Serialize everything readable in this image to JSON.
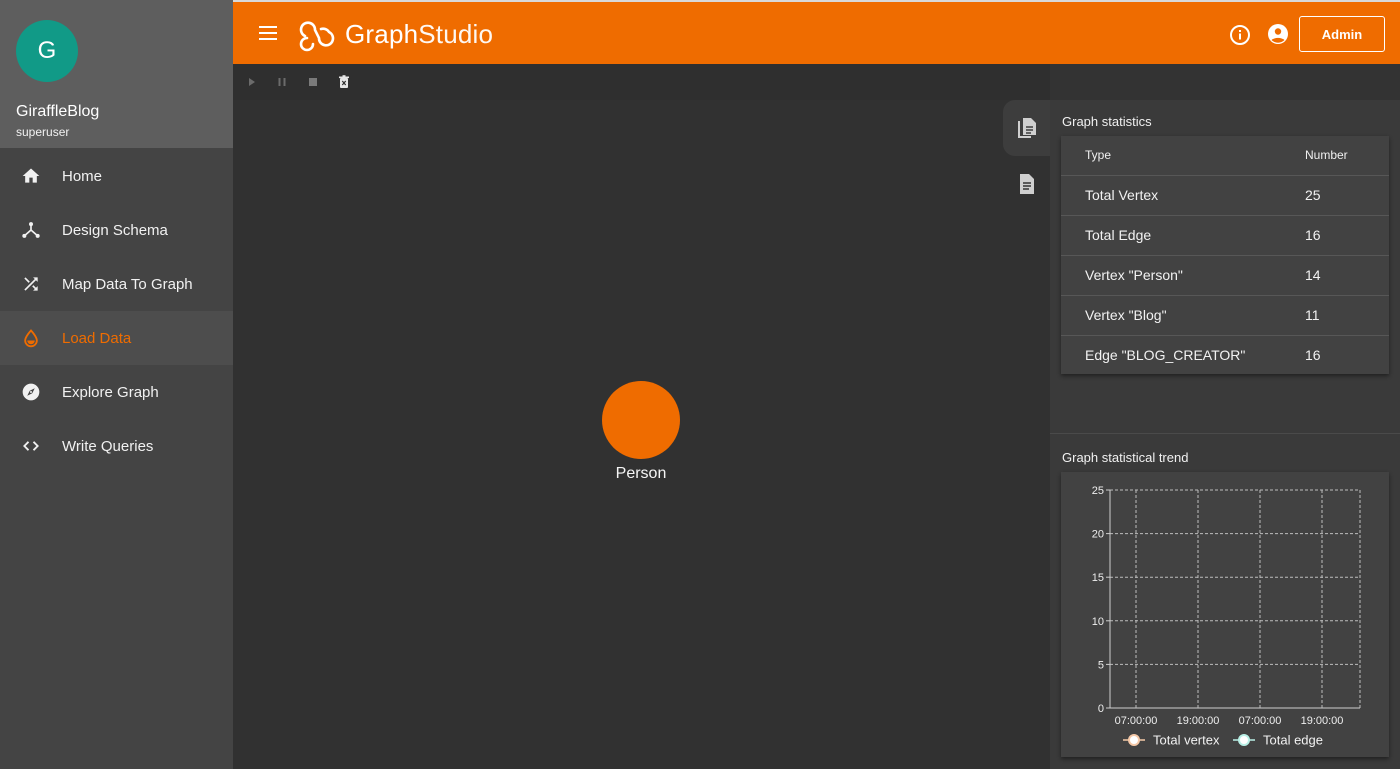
{
  "profile": {
    "avatar_letter": "G",
    "name": "GiraffleBlog",
    "role": "superuser"
  },
  "nav": {
    "items": [
      {
        "label": "Home",
        "icon": "home-icon"
      },
      {
        "label": "Design Schema",
        "icon": "schema-icon"
      },
      {
        "label": "Map Data To Graph",
        "icon": "shuffle-icon"
      },
      {
        "label": "Load Data",
        "icon": "water-drop-icon"
      },
      {
        "label": "Explore Graph",
        "icon": "compass-icon"
      },
      {
        "label": "Write Queries",
        "icon": "code-icon"
      }
    ],
    "active_index": 3
  },
  "header": {
    "logo_main": "Graph",
    "logo_studio": "Studio",
    "admin_label": "Admin",
    "brand_color": "#ef6c00"
  },
  "toolbar": {
    "icons": [
      "play-icon",
      "pause-icon",
      "stop-icon",
      "delete-icon"
    ]
  },
  "canvas": {
    "node_label": "Person",
    "node_color": "#ef6c00"
  },
  "stats": {
    "title": "Graph statistics",
    "columns": [
      "Type",
      "Number"
    ],
    "rows": [
      {
        "type": "Total Vertex",
        "number": "25"
      },
      {
        "type": "Total Edge",
        "number": "16"
      },
      {
        "type": "Vertex \"Person\"",
        "number": "14"
      },
      {
        "type": "Vertex \"Blog\"",
        "number": "11"
      },
      {
        "type": "Edge \"BLOG_CREATOR\"",
        "number": "16"
      }
    ]
  },
  "trend": {
    "title": "Graph statistical trend"
  },
  "chart_data": {
    "type": "line",
    "x": [
      "07:00:00",
      "19:00:00",
      "07:00:00",
      "19:00:00"
    ],
    "ylim": [
      0,
      25
    ],
    "yticks": [
      0,
      5,
      10,
      15,
      20,
      25
    ],
    "grid": true,
    "legend_placement": "bottom",
    "series": [
      {
        "name": "Total vertex",
        "values": [],
        "color": "#f5c9a8"
      },
      {
        "name": "Total edge",
        "values": [],
        "color": "#b9f0e6"
      }
    ]
  }
}
